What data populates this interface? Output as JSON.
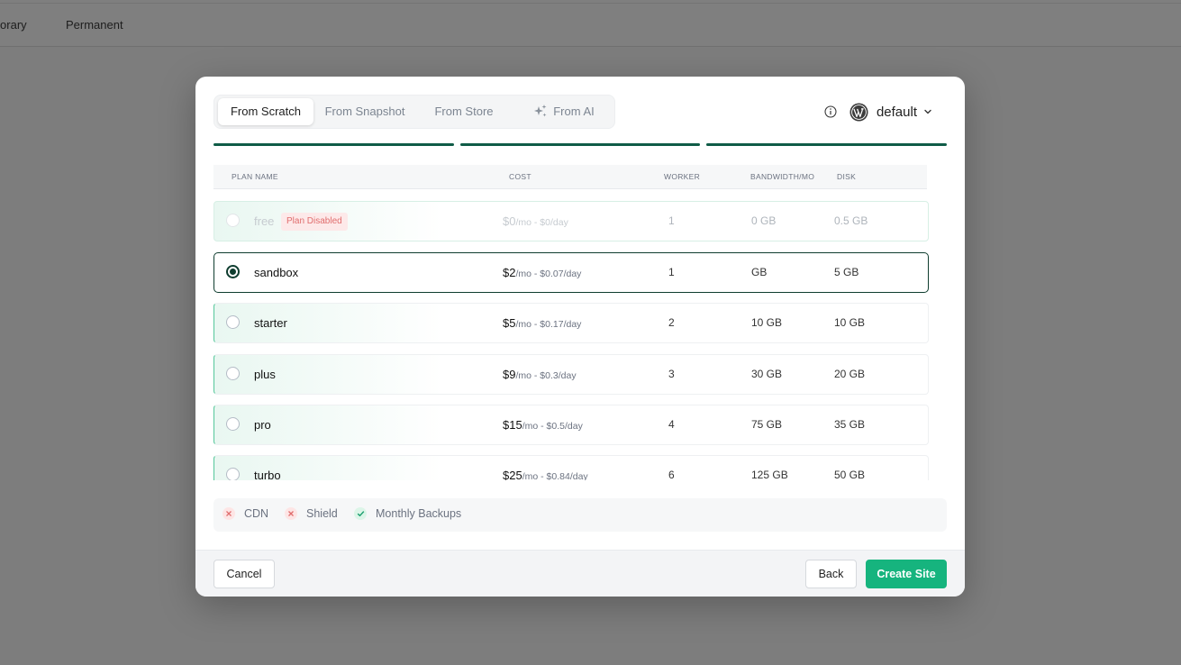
{
  "background": {
    "tabs": [
      "mporary",
      "Permanent"
    ]
  },
  "modal": {
    "tabs": [
      {
        "label": "From Scratch",
        "active": true
      },
      {
        "label": "From Snapshot",
        "active": false
      },
      {
        "label": "From Store",
        "active": false
      },
      {
        "label": "From AI",
        "active": false,
        "icon": "sparkle-icon"
      }
    ],
    "workspace": {
      "label": "default",
      "icons": [
        "info-icon",
        "wordpress-icon",
        "chevron-down-icon"
      ]
    },
    "progress_steps": 3,
    "colors": {
      "brand": "#0f5c47",
      "accent": "#16b47e",
      "selected_border": "#0f3d2f",
      "danger": "#e06d6d"
    },
    "table": {
      "headers": {
        "name": "PLAN NAME",
        "cost": "COST",
        "worker": "WORKER",
        "bandwidth": "BANDWIDTH/MO",
        "disk": "DISK"
      },
      "rows": [
        {
          "name": "free",
          "badge": "Plan Disabled",
          "cost": "$0",
          "cost_sub": "/mo - $0/day",
          "worker": "1",
          "bandwidth": "0 GB",
          "disk": "0.5 GB",
          "state": "disabled"
        },
        {
          "name": "sandbox",
          "badge": "",
          "cost": "$2",
          "cost_sub": "/mo - $0.07/day",
          "worker": "1",
          "bandwidth": "GB",
          "disk": "5 GB",
          "state": "selected"
        },
        {
          "name": "starter",
          "badge": "",
          "cost": "$5",
          "cost_sub": "/mo - $0.17/day",
          "worker": "2",
          "bandwidth": "10 GB",
          "disk": "10 GB",
          "state": "normal"
        },
        {
          "name": "plus",
          "badge": "",
          "cost": "$9",
          "cost_sub": "/mo - $0.3/day",
          "worker": "3",
          "bandwidth": "30 GB",
          "disk": "20 GB",
          "state": "normal"
        },
        {
          "name": "pro",
          "badge": "",
          "cost": "$15",
          "cost_sub": "/mo - $0.5/day",
          "worker": "4",
          "bandwidth": "75 GB",
          "disk": "35 GB",
          "state": "normal"
        },
        {
          "name": "turbo",
          "badge": "",
          "cost": "$25",
          "cost_sub": "/mo - $0.84/day",
          "worker": "6",
          "bandwidth": "125 GB",
          "disk": "50 GB",
          "state": "normal"
        }
      ]
    },
    "features": [
      {
        "label": "CDN",
        "enabled": false
      },
      {
        "label": "Shield",
        "enabled": false
      },
      {
        "label": "Monthly Backups",
        "enabled": true
      }
    ],
    "footer": {
      "cancel": "Cancel",
      "back": "Back",
      "create": "Create Site"
    }
  }
}
